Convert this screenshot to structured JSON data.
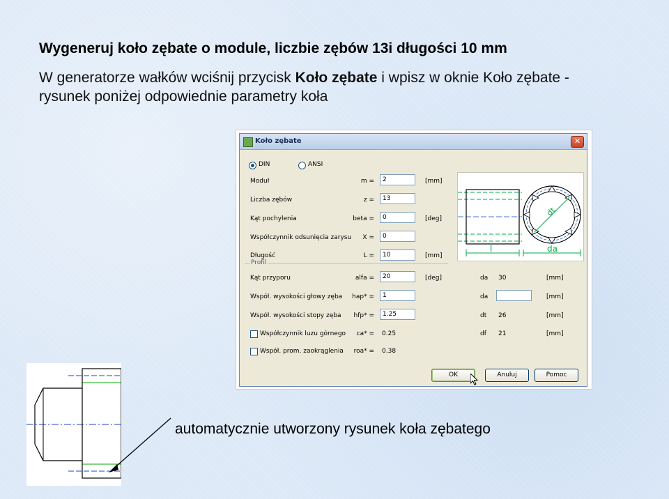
{
  "slide": {
    "title": "Wygeneruj koło zębate o module, liczbie zębów 13i długości 10 mm",
    "para_part1": "W generatorze wałków wciśnij przycisk ",
    "para_bold": "Koło zębate",
    "para_part2": " i wpisz w oknie Koło zębate - rysunek poniżej odpowiednie parametry koła",
    "caption": "automatycznie utworzony rysunek koła zębatego"
  },
  "dialog": {
    "title": "Koło zębate",
    "close": "✕",
    "radio_din": "DIN",
    "radio_ansi": "ANSI",
    "group_profil": "Profil",
    "fields": [
      {
        "label": "Moduł",
        "sym": "m =",
        "value": "2",
        "unit": "[mm]"
      },
      {
        "label": "Liczba zębów",
        "sym": "z =",
        "value": "13",
        "unit": ""
      },
      {
        "label": "Kąt pochylenia",
        "sym": "beta =",
        "value": "0",
        "unit": "[deg]"
      },
      {
        "label": "Współczynnik odsunięcia zarysu",
        "sym": "X =",
        "value": "0",
        "unit": ""
      },
      {
        "label": "Długość",
        "sym": "L =",
        "value": "10",
        "unit": "[mm]"
      },
      {
        "label": "Kąt przyporu",
        "sym": "alfa =",
        "value": "20",
        "unit": "[deg]"
      },
      {
        "label": "Współ. wysokości głowy zęba",
        "sym": "hap* =",
        "value": "1",
        "unit": ""
      },
      {
        "label": "Współ. wysokości stopy zęba",
        "sym": "hfp* =",
        "value": "1.25",
        "unit": ""
      }
    ],
    "checks": [
      {
        "label": "Współczynnik luzu górnego",
        "sym": "ca* =",
        "value": "0.25"
      },
      {
        "label": "Współ. prom. zaokrąglenia",
        "sym": "roa* =",
        "value": "0.38"
      }
    ],
    "results": [
      {
        "sym": "da",
        "value": "30",
        "unit": "[mm]"
      },
      {
        "sym": "da",
        "value": "",
        "unit": "[mm]"
      },
      {
        "sym": "dt",
        "value": "26",
        "unit": "[mm]"
      },
      {
        "sym": "df",
        "value": "21",
        "unit": "[mm]"
      }
    ],
    "preview_labels": {
      "l": "l",
      "da": "da",
      "dt": "dt"
    },
    "buttons": {
      "ok": "OK",
      "cancel": "Anuluj",
      "help": "Pomoc"
    }
  }
}
